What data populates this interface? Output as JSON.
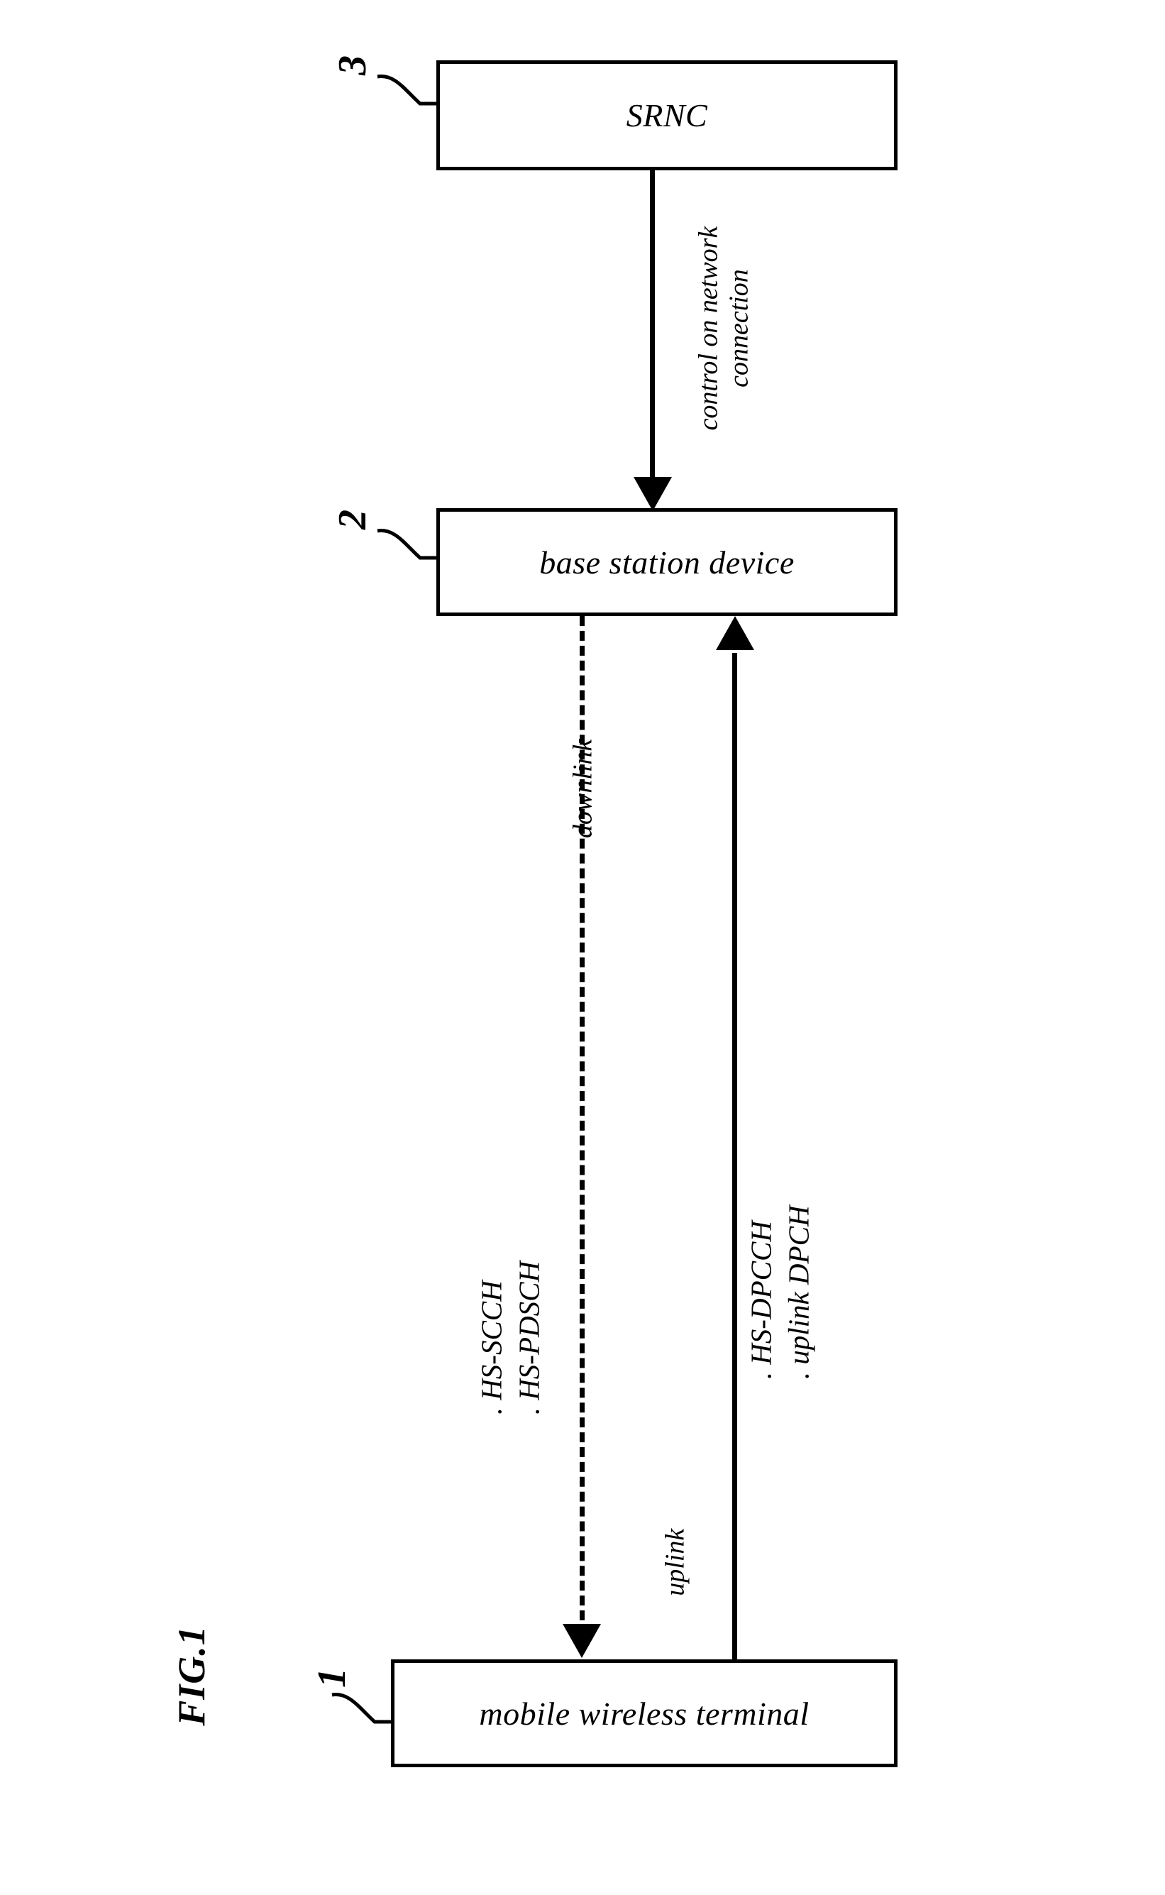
{
  "figure": {
    "caption": "FIG.1"
  },
  "nodes": [
    {
      "id": "srnc",
      "label": "SRNC",
      "ref": "3"
    },
    {
      "id": "base_station",
      "label": "base station device",
      "ref": "2"
    },
    {
      "id": "mobile_terminal",
      "label": "mobile wireless terminal",
      "ref": "1"
    }
  ],
  "connections": {
    "control": {
      "label_line1": "control on network",
      "label_line2": "connection",
      "style": "solid",
      "direction": "srnc-to-base-station"
    },
    "downlink": {
      "label": "downlink",
      "style": "dashed",
      "direction": "base-station-to-mobile-terminal",
      "channels": [
        ". HS-SCCH",
        ". HS-PDSCH"
      ],
      "channel_names": [
        "HS-SCCH",
        "HS-PDSCH"
      ]
    },
    "uplink": {
      "label": "uplink",
      "style": "solid",
      "direction": "mobile-terminal-to-base-station",
      "channels": [
        ". HS-DPCCH",
        ". uplink DPCH"
      ],
      "channel_names": [
        "HS-DPCCH",
        "uplink DPCH"
      ]
    }
  },
  "colors": {
    "ink": "#000000",
    "paper": "#ffffff"
  }
}
